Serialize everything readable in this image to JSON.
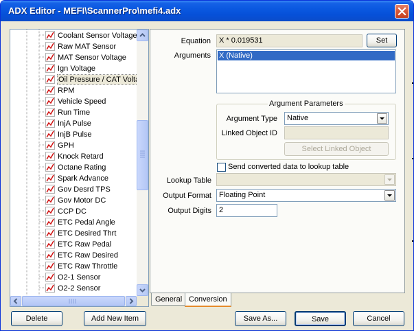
{
  "window": {
    "title": "ADX Editor - MEFI\\ScannerPro\\mefi4.adx",
    "close_icon": "close-icon"
  },
  "tree": {
    "items": [
      {
        "label": "Coolant Sensor Voltage",
        "selected": false
      },
      {
        "label": "Raw MAT Sensor",
        "selected": false
      },
      {
        "label": "MAT Sensor Voltage",
        "selected": false
      },
      {
        "label": "Ign Voltage",
        "selected": false
      },
      {
        "label": "Oil Pressure / CAT Voltage",
        "selected": true
      },
      {
        "label": "RPM",
        "selected": false
      },
      {
        "label": "Vehicle Speed",
        "selected": false
      },
      {
        "label": "Run Time",
        "selected": false
      },
      {
        "label": "InjA Pulse",
        "selected": false
      },
      {
        "label": "InjB Pulse",
        "selected": false
      },
      {
        "label": "GPH",
        "selected": false
      },
      {
        "label": "Knock Retard",
        "selected": false
      },
      {
        "label": "Octane Rating",
        "selected": false
      },
      {
        "label": "Spark Advance",
        "selected": false
      },
      {
        "label": "Gov Desrd TPS",
        "selected": false
      },
      {
        "label": "Gov Motor DC",
        "selected": false
      },
      {
        "label": "CCP DC",
        "selected": false
      },
      {
        "label": "ETC Pedal Angle",
        "selected": false
      },
      {
        "label": "ETC Desired Thrt",
        "selected": false
      },
      {
        "label": "ETC Raw Pedal",
        "selected": false
      },
      {
        "label": "ETC Raw Desired",
        "selected": false
      },
      {
        "label": "ETC Raw Throttle",
        "selected": false
      },
      {
        "label": "O2-1 Sensor",
        "selected": false
      },
      {
        "label": "O2-2 Sensor",
        "selected": false
      }
    ]
  },
  "conversion": {
    "equation_label": "Equation",
    "equation_value": "X * 0.019531",
    "set_button": "Set",
    "arguments_label": "Arguments",
    "arguments": [
      "X (Native)"
    ],
    "arg_params_title": "Argument Parameters",
    "arg_type_label": "Argument Type",
    "arg_type_value": "Native",
    "linked_object_label": "Linked Object ID",
    "linked_object_value": "",
    "select_linked_button": "Select Linked Object",
    "send_lookup_label": "Send converted data to lookup table",
    "lookup_table_label": "Lookup Table",
    "lookup_table_value": "",
    "output_format_label": "Output Format",
    "output_format_value": "Floating Point",
    "output_digits_label": "Output Digits",
    "output_digits_value": "2"
  },
  "tabs": [
    {
      "label": "General",
      "active": false
    },
    {
      "label": "Conversion",
      "active": true
    }
  ],
  "footer": {
    "delete": "Delete",
    "add_new_item": "Add New Item",
    "save_as": "Save As...",
    "save": "Save",
    "cancel": "Cancel"
  }
}
